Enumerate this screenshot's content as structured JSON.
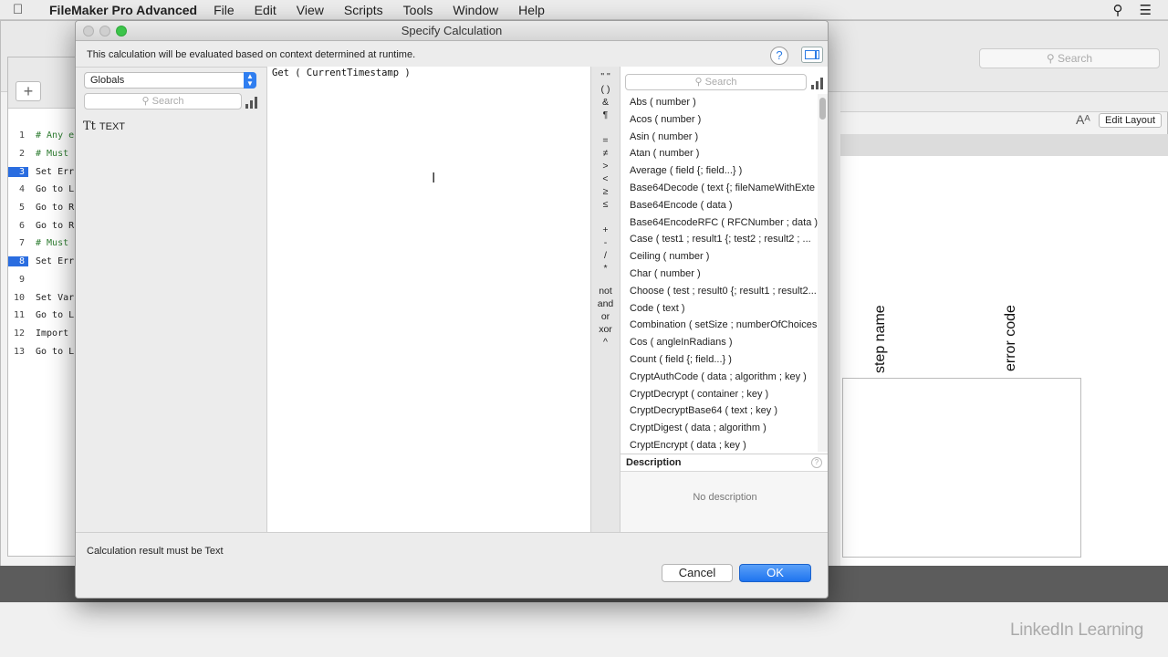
{
  "menubar": {
    "app_name": "FileMaker Pro Advanced",
    "menus": [
      "File",
      "Edit",
      "View",
      "Scripts",
      "Tools",
      "Window",
      "Help"
    ]
  },
  "background": {
    "search_placeholder": "Search",
    "aa_label": "Aᴬ",
    "edit_layout": "Edit Layout",
    "col_step_name": "step name",
    "col_error_code": "error code",
    "script_lines": [
      {
        "num": "1",
        "text": "# Any e",
        "comment": true,
        "bp": false
      },
      {
        "num": "2",
        "text": "# Must",
        "comment": true,
        "bp": false
      },
      {
        "num": "3",
        "text": "Set Err",
        "comment": false,
        "bp": true
      },
      {
        "num": "4",
        "text": "Go to L",
        "comment": false,
        "bp": false
      },
      {
        "num": "5",
        "text": "Go to R",
        "comment": false,
        "bp": false
      },
      {
        "num": "6",
        "text": "Go to R",
        "comment": false,
        "bp": false
      },
      {
        "num": "7",
        "text": "# Must",
        "comment": true,
        "bp": false
      },
      {
        "num": "8",
        "text": "Set Err",
        "comment": false,
        "bp": true
      },
      {
        "num": "9",
        "text": "",
        "comment": false,
        "bp": false
      },
      {
        "num": "10",
        "text": "Set Var",
        "comment": false,
        "bp": false
      },
      {
        "num": "11",
        "text": "Go to L",
        "comment": false,
        "bp": false
      },
      {
        "num": "12",
        "text": "Import",
        "comment": false,
        "bp": false
      },
      {
        "num": "13",
        "text": "Go to L",
        "comment": false,
        "bp": false
      }
    ]
  },
  "dialog": {
    "title": "Specify Calculation",
    "subtitle": "This calculation will be evaluated based on context determined at runtime.",
    "help_label": "?",
    "field_context": "Globals",
    "left_search_placeholder": "Search",
    "type_icon": "Tt",
    "type_label": "TEXT",
    "formula": "Get ( CurrentTimestamp )",
    "operators": [
      "\" \"",
      "( )",
      "&",
      "¶",
      "=",
      "≠",
      ">",
      "<",
      "≥",
      "≤",
      "+",
      "-",
      "/",
      "*",
      "not",
      "and",
      "or",
      "xor",
      "^"
    ],
    "function_search_placeholder": "Search",
    "functions": [
      "Abs ( number )",
      "Acos ( number )",
      "Asin ( number )",
      "Atan ( number )",
      "Average ( field {; field...} )",
      "Base64Decode ( text {; fileNameWithExte",
      "Base64Encode ( data )",
      "Base64EncodeRFC ( RFCNumber ; data )",
      "Case ( test1 ; result1 {; test2 ; result2 ; ...",
      "Ceiling ( number )",
      "Char ( number )",
      "Choose ( test ; result0 {; result1 ; result2...",
      "Code ( text )",
      "Combination ( setSize ; numberOfChoices",
      "Cos ( angleInRadians )",
      "Count ( field {; field...} )",
      "CryptAuthCode ( data ; algorithm ; key )",
      "CryptDecrypt ( container ; key )",
      "CryptDecryptBase64 ( text ; key )",
      "CryptDigest ( data ; algorithm )",
      "CryptEncrypt ( data ; key )"
    ],
    "description_header": "Description",
    "description_text": "No description",
    "result_label": "Calculation result must be  Text",
    "cancel_label": "Cancel",
    "ok_label": "OK"
  },
  "watermark": "LinkedIn Learning"
}
